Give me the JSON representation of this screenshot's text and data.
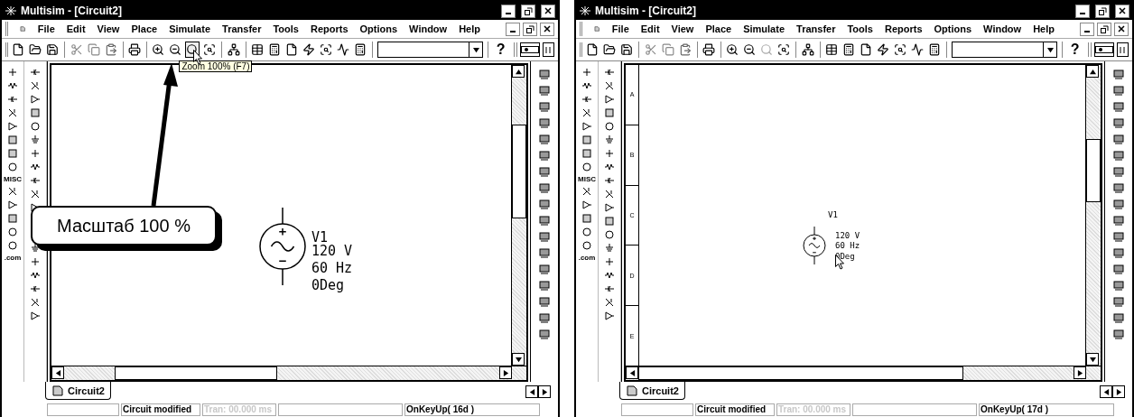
{
  "windows": [
    {
      "kind": "zoomed",
      "title": "Multisim - [Circuit2]",
      "menu": [
        "File",
        "Edit",
        "View",
        "Place",
        "Simulate",
        "Transfer",
        "Tools",
        "Reports",
        "Options",
        "Window",
        "Help"
      ],
      "zoom_100": {
        "disabled": false,
        "hovered": true
      },
      "help": "?",
      "tooltip": "Zoom 100% (F7)",
      "callout": "Масштаб 100 %",
      "misc_label": "MISC",
      "com_label": ".com",
      "component": {
        "name": "V1",
        "values": [
          "120 V",
          "60 Hz",
          "0Deg"
        ]
      },
      "tab": "Circuit2",
      "status": [
        {
          "text": "Circuit modified",
          "disabled": false
        },
        {
          "text": "Tran: 00.000 ms",
          "disabled": true
        },
        {
          "text": "OnKeyUp( 16d )",
          "disabled": false
        }
      ]
    },
    {
      "kind": "fit",
      "title": "Multisim - [Circuit2]",
      "menu": [
        "File",
        "Edit",
        "View",
        "Place",
        "Simulate",
        "Transfer",
        "Tools",
        "Reports",
        "Options",
        "Window",
        "Help"
      ],
      "zoom_100": {
        "disabled": true,
        "hovered": false
      },
      "help": "?",
      "misc_label": "MISC",
      "com_label": ".com",
      "border_labels": [
        "A",
        "B",
        "C",
        "D",
        "E"
      ],
      "component": {
        "name": "V1",
        "values": [
          "120 V",
          "60 Hz",
          "0Deg"
        ]
      },
      "tab": "Circuit2",
      "status": [
        {
          "text": "Circuit modified",
          "disabled": false
        },
        {
          "text": "Tran: 00.000 ms",
          "disabled": true
        },
        {
          "text": "OnKeyUp( 17d )",
          "disabled": false
        }
      ]
    }
  ]
}
